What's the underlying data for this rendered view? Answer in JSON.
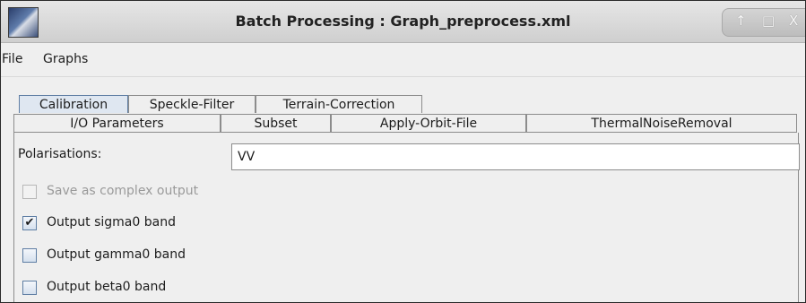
{
  "window": {
    "title": "Batch Processing : Graph_preprocess.xml",
    "controls": [
      "↑",
      "□",
      "X"
    ]
  },
  "menu": {
    "items": [
      "File",
      "Graphs"
    ]
  },
  "tabs_row1": [
    "Calibration",
    "Speckle-Filter",
    "Terrain-Correction"
  ],
  "tabs_row2": [
    "I/O Parameters",
    "Subset",
    "Apply-Orbit-File",
    "ThermalNoiseRemoval"
  ],
  "active_tab": "Calibration",
  "form": {
    "polarisations_label": "Polarisations:",
    "polarisations_value": "VV"
  },
  "options": [
    {
      "label": "Save as complex output",
      "checked": false,
      "enabled": false
    },
    {
      "label": "Output sigma0 band",
      "checked": true,
      "enabled": true
    },
    {
      "label": "Output gamma0 band",
      "checked": false,
      "enabled": true
    },
    {
      "label": "Output beta0 band",
      "checked": false,
      "enabled": true
    }
  ],
  "check_mark": "✔",
  "colors": {
    "accent": "#5f7ea4",
    "active_tab": "#dfe7f1",
    "background": "#efefef"
  }
}
